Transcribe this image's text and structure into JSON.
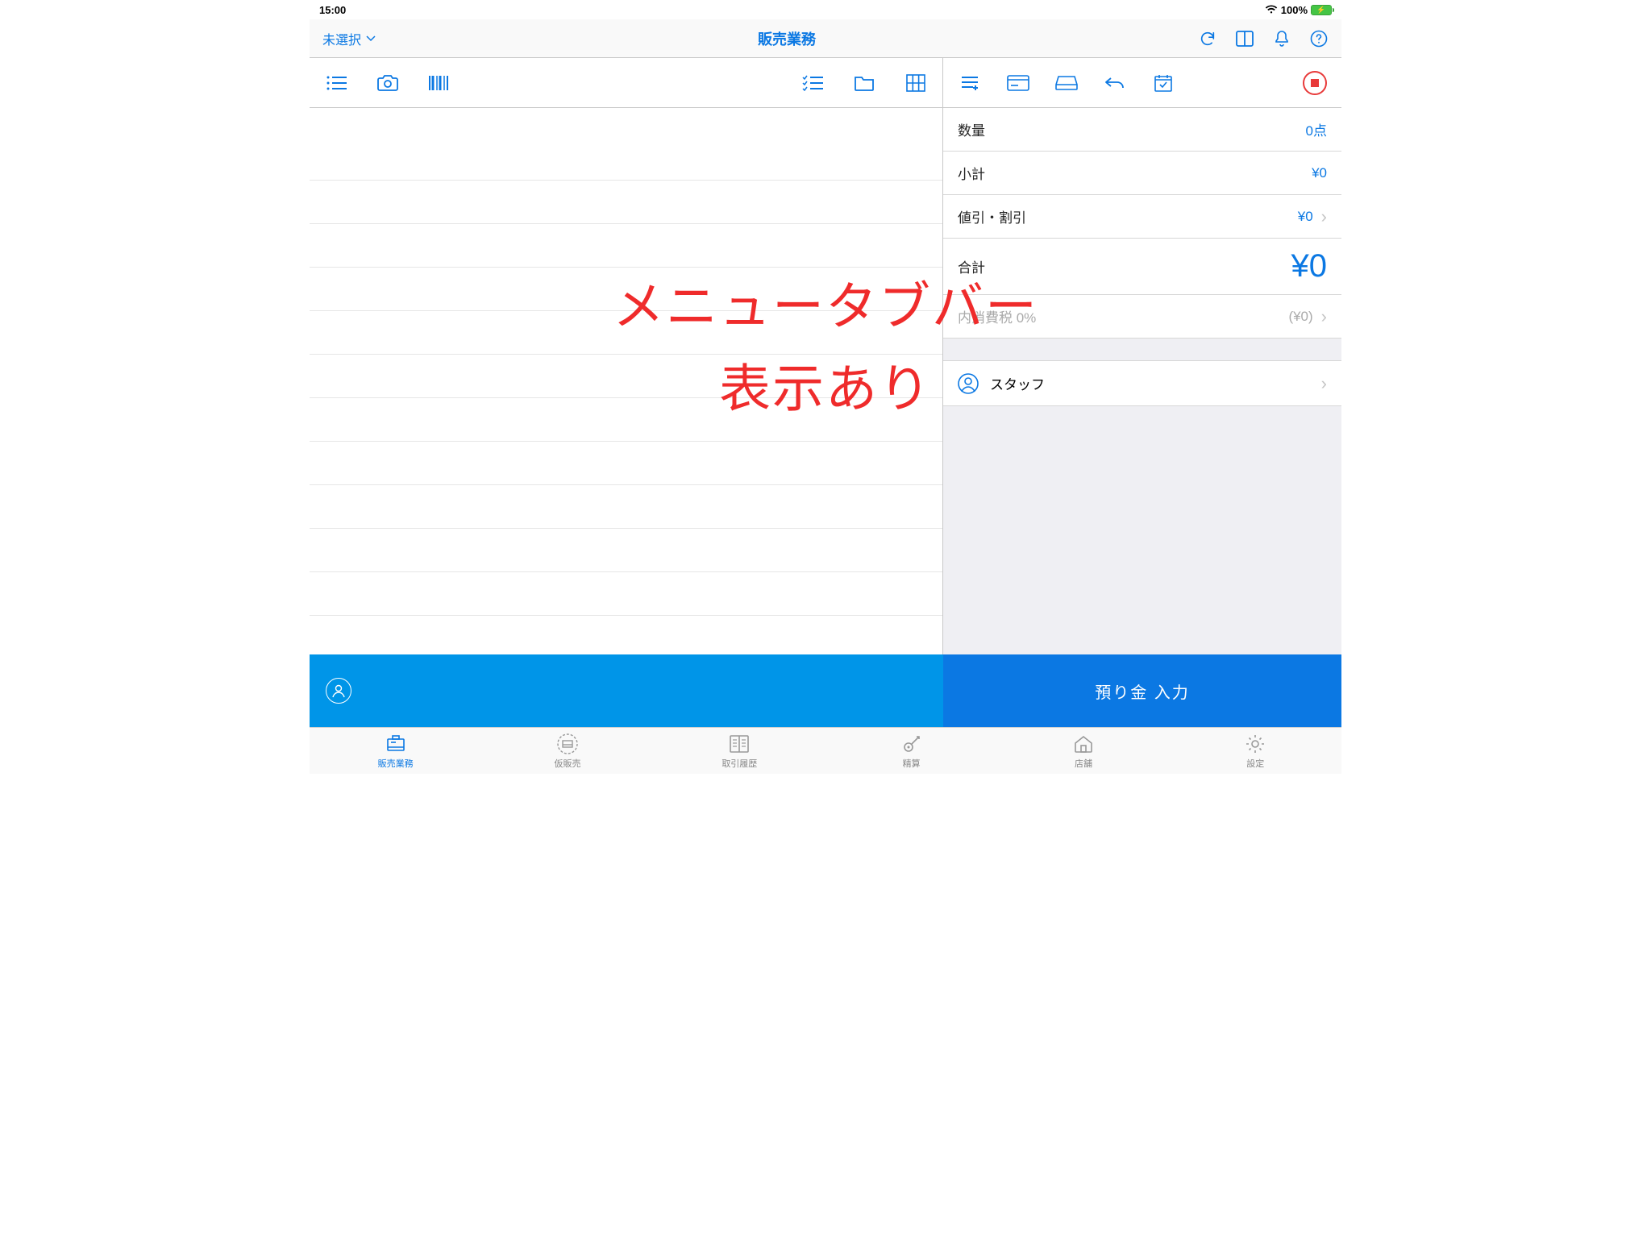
{
  "status": {
    "time": "15:00",
    "battery": "100%"
  },
  "nav": {
    "left_label": "未選択",
    "title": "販売業務"
  },
  "summary": {
    "qty_label": "数量",
    "qty_value": "0点",
    "subtotal_label": "小計",
    "subtotal_value": "¥0",
    "discount_label": "値引・割引",
    "discount_value": "¥0",
    "total_label": "合計",
    "total_value": "¥0",
    "tax_label": "内消費税 0%",
    "tax_value": "(¥0)",
    "staff_label": "スタッフ"
  },
  "actions": {
    "deposit": "預り金 入力"
  },
  "tabs": [
    {
      "label": "販売業務"
    },
    {
      "label": "仮販売"
    },
    {
      "label": "取引履歴"
    },
    {
      "label": "精算"
    },
    {
      "label": "店舗"
    },
    {
      "label": "設定"
    }
  ],
  "annotation": {
    "line1": "メニュータブバー",
    "line2": "表示あり"
  }
}
